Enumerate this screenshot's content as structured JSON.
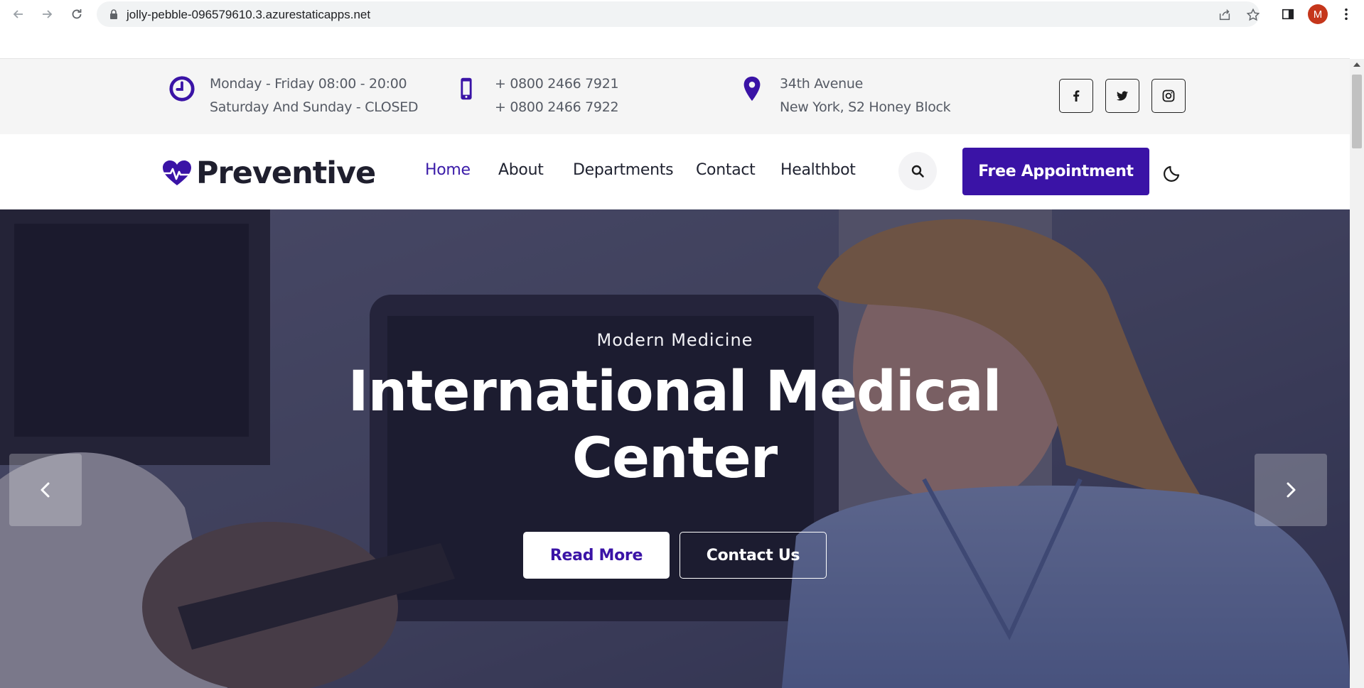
{
  "browser": {
    "url": "jolly-pebble-096579610.3.azurestaticapps.net",
    "profile_initial": "M"
  },
  "topbar": {
    "hours": {
      "icon": "clock-icon",
      "line1": "Monday - Friday 08:00 - 20:00",
      "line2": "Saturday And Sunday - CLOSED"
    },
    "phone": {
      "icon": "mobile-phone-icon",
      "line1": "+ 0800 2466 7921",
      "line2": "+ 0800 2466 7922"
    },
    "address": {
      "icon": "map-pin-icon",
      "line1": "34th Avenue",
      "line2": "New York, S2 Honey Block"
    },
    "social": [
      "facebook-icon",
      "twitter-icon",
      "instagram-icon"
    ]
  },
  "nav": {
    "logo_text": "Preventive",
    "links": [
      "Home",
      "About",
      "Departments",
      "Contact",
      "Healthbot"
    ],
    "active": "Home",
    "cta_label": "Free Appointment"
  },
  "hero": {
    "subtitle": "Modern Medicine",
    "title": "International Medical Center",
    "primary_button": "Read More",
    "secondary_button": "Contact Us"
  },
  "colors": {
    "brand": "#3a13a6",
    "topbar_bg": "#f5f5f5",
    "text": "#1f2230"
  }
}
